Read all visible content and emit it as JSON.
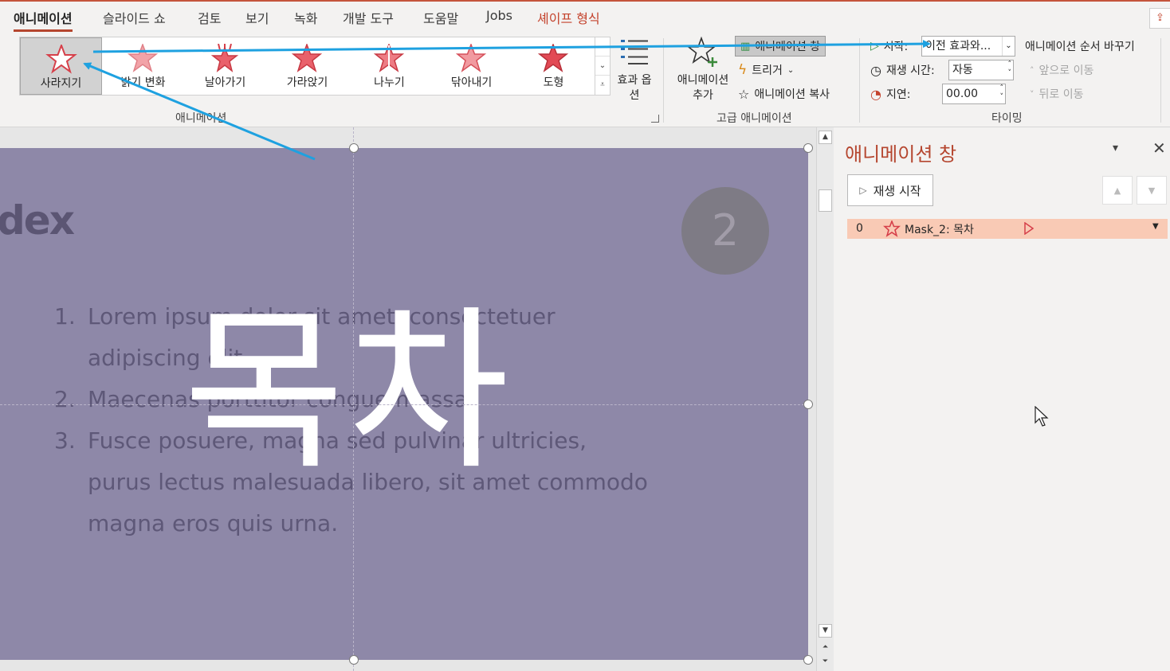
{
  "tabs": [
    {
      "label": "애니메이션",
      "active": true
    },
    {
      "label": "슬라이드 쇼"
    },
    {
      "label": "검토"
    },
    {
      "label": "보기"
    },
    {
      "label": "녹화"
    },
    {
      "label": "개발 도구"
    },
    {
      "label": "도움말"
    },
    {
      "label": "Jobs"
    },
    {
      "label": "셰이프 형식",
      "accent": true
    }
  ],
  "gallery": {
    "items": [
      {
        "label": "사라지기",
        "selected": true
      },
      {
        "label": "밝기 변화"
      },
      {
        "label": "날아가기"
      },
      {
        "label": "가라앉기"
      },
      {
        "label": "나누기"
      },
      {
        "label": "닦아내기"
      },
      {
        "label": "도형"
      }
    ],
    "effect_options_label": "효과 옵션",
    "group_label": "애니메이션"
  },
  "advanced": {
    "add_animation_label": "애니메이션 추가",
    "animation_pane_label": "애니메이션 창",
    "trigger_label": "트리거",
    "painter_label": "애니메이션 복사",
    "group_label": "고급 애니메이션"
  },
  "timing": {
    "start_label": "시작:",
    "start_value": "이전 효과와...",
    "duration_label": "재생 시간:",
    "duration_value": "자동",
    "delay_label": "지연:",
    "delay_value": "00.00",
    "reorder_label": "애니메이션 순서 바꾸기",
    "move_earlier_label": "앞으로 이동",
    "move_later_label": "뒤로 이동",
    "group_label": "타이밍"
  },
  "slide": {
    "title": "dex",
    "badge": "2",
    "list": [
      {
        "num": "1.",
        "text": "Lorem ipsum dolor sit amet, consectetuer adipiscing elit."
      },
      {
        "num": "2.",
        "text": "Maecenas porttitor congue massa."
      },
      {
        "num": "3.",
        "text": "Fusce posuere, magna sed pulvinar ultricies, purus lectus malesuada libero, sit amet commodo magna eros quis urna."
      }
    ],
    "overlay_text": "목차",
    "background_color": "#8e88a8"
  },
  "pane": {
    "title": "애니메이션 창",
    "play_label": "재생 시작",
    "items": [
      {
        "index": "0",
        "name": "Mask_2: 목차"
      }
    ]
  },
  "colors": {
    "accent": "#b5462f",
    "arrow": "#1ea1e0",
    "highlight": "#f9cab5"
  }
}
